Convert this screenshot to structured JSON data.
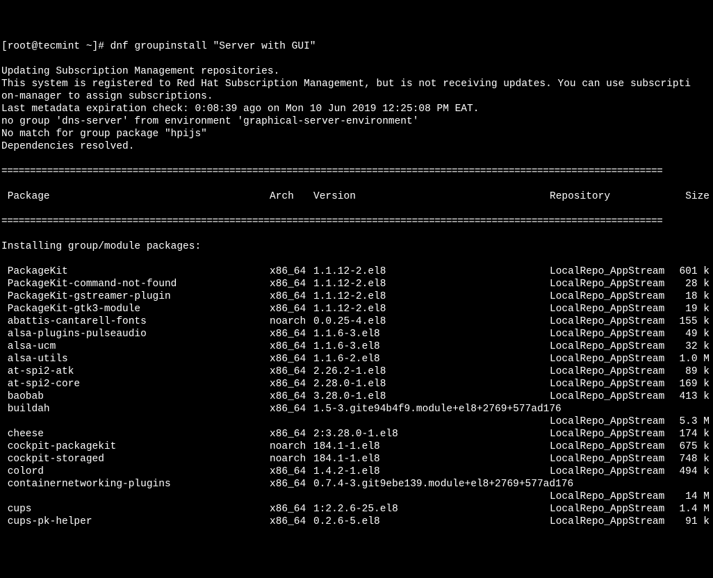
{
  "prompt": "[root@tecmint ~]# ",
  "command": "dnf groupinstall \"Server with GUI\"",
  "preamble": [
    "Updating Subscription Management repositories.",
    "This system is registered to Red Hat Subscription Management, but is not receiving updates. You can use subscripti",
    "on-manager to assign subscriptions.",
    "Last metadata expiration check: 0:08:39 ago on Mon 10 Jun 2019 12:25:08 PM EAT.",
    "no group 'dns-server' from environment 'graphical-server-environment'",
    "No match for group package \"hpijs\"",
    "Dependencies resolved."
  ],
  "divider": "====================================================================================================================",
  "header": {
    "pkg": " Package",
    "arch": "Arch",
    "ver": "Version",
    "repo": "Repository",
    "size": "Size"
  },
  "section_label": "Installing group/module packages:",
  "packages": [
    {
      "pkg": "PackageKit",
      "arch": "x86_64",
      "ver": "1.1.12-2.el8",
      "repo": "LocalRepo_AppStream",
      "size": "601 k"
    },
    {
      "pkg": "PackageKit-command-not-found",
      "arch": "x86_64",
      "ver": "1.1.12-2.el8",
      "repo": "LocalRepo_AppStream",
      "size": " 28 k"
    },
    {
      "pkg": "PackageKit-gstreamer-plugin",
      "arch": "x86_64",
      "ver": "1.1.12-2.el8",
      "repo": "LocalRepo_AppStream",
      "size": " 18 k"
    },
    {
      "pkg": "PackageKit-gtk3-module",
      "arch": "x86_64",
      "ver": "1.1.12-2.el8",
      "repo": "LocalRepo_AppStream",
      "size": " 19 k"
    },
    {
      "pkg": "abattis-cantarell-fonts",
      "arch": "noarch",
      "ver": "0.0.25-4.el8",
      "repo": "LocalRepo_AppStream",
      "size": "155 k"
    },
    {
      "pkg": "alsa-plugins-pulseaudio",
      "arch": "x86_64",
      "ver": "1.1.6-3.el8",
      "repo": "LocalRepo_AppStream",
      "size": " 49 k"
    },
    {
      "pkg": "alsa-ucm",
      "arch": "x86_64",
      "ver": "1.1.6-3.el8",
      "repo": "LocalRepo_AppStream",
      "size": " 32 k"
    },
    {
      "pkg": "alsa-utils",
      "arch": "x86_64",
      "ver": "1.1.6-2.el8",
      "repo": "LocalRepo_AppStream",
      "size": "1.0 M"
    },
    {
      "pkg": "at-spi2-atk",
      "arch": "x86_64",
      "ver": "2.26.2-1.el8",
      "repo": "LocalRepo_AppStream",
      "size": " 89 k"
    },
    {
      "pkg": "at-spi2-core",
      "arch": "x86_64",
      "ver": "2.28.0-1.el8",
      "repo": "LocalRepo_AppStream",
      "size": "169 k"
    },
    {
      "pkg": "baobab",
      "arch": "x86_64",
      "ver": "3.28.0-1.el8",
      "repo": "LocalRepo_AppStream",
      "size": "413 k"
    },
    {
      "pkg": "buildah",
      "arch": "x86_64",
      "ver": "1.5-3.gite94b4f9.module+el8+2769+577ad176",
      "repo": "",
      "size": ""
    },
    {
      "pkg": "",
      "arch": "",
      "ver": "",
      "repo": "LocalRepo_AppStream",
      "size": "5.3 M"
    },
    {
      "pkg": "cheese",
      "arch": "x86_64",
      "ver": "2:3.28.0-1.el8",
      "repo": "LocalRepo_AppStream",
      "size": "174 k"
    },
    {
      "pkg": "cockpit-packagekit",
      "arch": "noarch",
      "ver": "184.1-1.el8",
      "repo": "LocalRepo_AppStream",
      "size": "675 k"
    },
    {
      "pkg": "cockpit-storaged",
      "arch": "noarch",
      "ver": "184.1-1.el8",
      "repo": "LocalRepo_AppStream",
      "size": "748 k"
    },
    {
      "pkg": "colord",
      "arch": "x86_64",
      "ver": "1.4.2-1.el8",
      "repo": "LocalRepo_AppStream",
      "size": "494 k"
    },
    {
      "pkg": "containernetworking-plugins",
      "arch": "x86_64",
      "ver": "0.7.4-3.git9ebe139.module+el8+2769+577ad176",
      "repo": "",
      "size": ""
    },
    {
      "pkg": "",
      "arch": "",
      "ver": "",
      "repo": "LocalRepo_AppStream",
      "size": " 14 M"
    },
    {
      "pkg": "cups",
      "arch": "x86_64",
      "ver": "1:2.2.6-25.el8",
      "repo": "LocalRepo_AppStream",
      "size": "1.4 M"
    },
    {
      "pkg": "cups-pk-helper",
      "arch": "x86_64",
      "ver": "0.2.6-5.el8",
      "repo": "LocalRepo_AppStream",
      "size": " 91 k"
    }
  ]
}
